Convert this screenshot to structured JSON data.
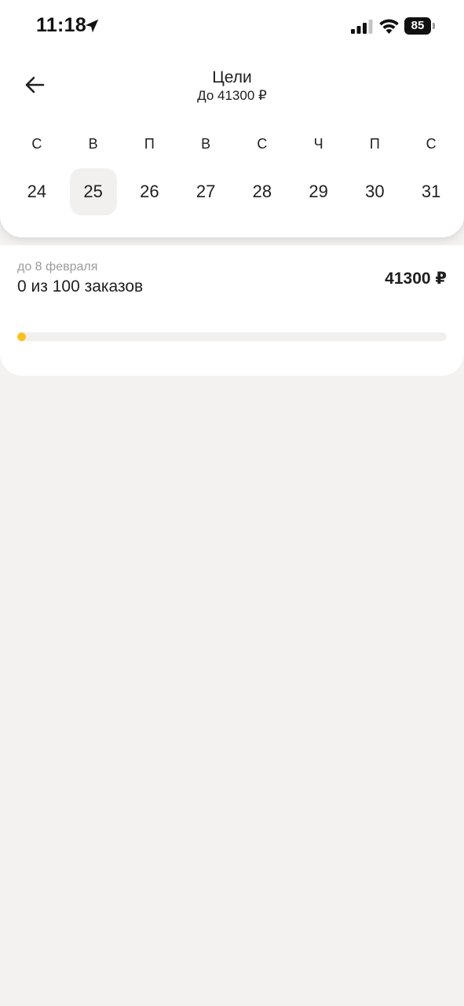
{
  "status_bar": {
    "time": "11:18",
    "battery": "85",
    "icons": [
      "location-arrow-icon",
      "cellular-signal-icon",
      "wifi-icon",
      "battery-icon"
    ]
  },
  "header": {
    "title": "Цели",
    "subtitle": "До 41300 ₽",
    "back_icon": "arrow-left-icon"
  },
  "calendar": {
    "weekdays": [
      "С",
      "В",
      "П",
      "В",
      "С",
      "Ч",
      "П",
      "С"
    ],
    "dates": [
      "24",
      "25",
      "26",
      "27",
      "28",
      "29",
      "30",
      "31"
    ],
    "selected_date": "25"
  },
  "goal": {
    "deadline": "до 8 февраля",
    "progress_text": "0 из 100 заказов",
    "amount": "41300 ₽",
    "completed": 0,
    "total": 100,
    "progress_color": "#fbc21a"
  },
  "colors": {
    "background": "#f3f2f0",
    "card": "#ffffff",
    "accent": "#fbc21a",
    "secondary_text": "#9b9b9b"
  }
}
